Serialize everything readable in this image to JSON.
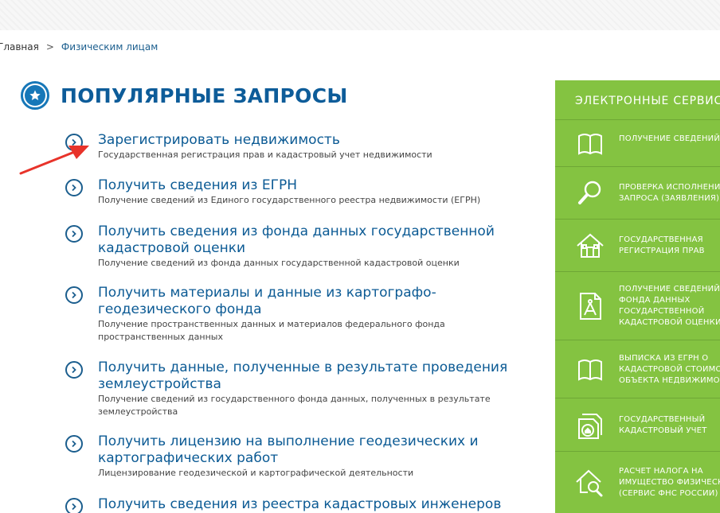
{
  "breadcrumb": {
    "home": "Главная",
    "separator": ">",
    "current": "Физическим лицам"
  },
  "section": {
    "title": "ПОПУЛЯРНЫЕ ЗАПРОСЫ",
    "icon": "star-icon"
  },
  "queries": [
    {
      "title_lines": [
        "Зарегистрировать недвижимость"
      ],
      "desc_lines": [
        "Государственная регистрация прав и кадастровый учет недвижимости"
      ]
    },
    {
      "title_lines": [
        "Получить сведения из ЕГРН"
      ],
      "desc_lines": [
        "Получение сведений из Единого государственного реестра недвижимости (ЕГРН)"
      ]
    },
    {
      "title_lines": [
        "Получить сведения из фонда данных государственной",
        "кадастровой оценки"
      ],
      "desc_lines": [
        "Получение сведений из фонда данных государственной кадастровой оценки"
      ]
    },
    {
      "title_lines": [
        "Получить материалы и данные из картографо-",
        "геодезического фонда"
      ],
      "desc_lines": [
        "Получение пространственных данных и материалов федерального фонда",
        "пространственных данных"
      ]
    },
    {
      "title_lines": [
        "Получить данные, полученные в результате проведения",
        "землеустройства"
      ],
      "desc_lines": [
        "Получение сведений из государственного фонда данных, полученных в результате",
        "землеустройства"
      ]
    },
    {
      "title_lines": [
        "Получить лицензию на выполнение геодезических и",
        "картографических работ"
      ],
      "desc_lines": [
        "Лицензирование геодезической и картографической деятельности"
      ]
    },
    {
      "title_lines": [
        "Получить сведения из реестра кадастровых инженеров"
      ],
      "desc_lines": []
    }
  ],
  "services": {
    "title": "ЭЛЕКТРОННЫЕ СЕРВИС",
    "items": [
      {
        "icon": "book-icon",
        "label_lines": [
          "ПОЛУЧЕНИЕ СВЕДЕНИЙ Е"
        ]
      },
      {
        "icon": "magnifier-icon",
        "label_lines": [
          "ПРОВЕРКА ИСПОЛНЕНИЯ",
          "ЗАПРОСА (ЗАЯВЛЕНИЯ)"
        ]
      },
      {
        "icon": "house-icon",
        "label_lines": [
          "ГОСУДАРСТВЕННАЯ",
          "РЕГИСТРАЦИЯ ПРАВ"
        ]
      },
      {
        "icon": "compass-document-icon",
        "label_lines": [
          "ПОЛУЧЕНИЕ СВЕДЕНИЙ И",
          "ФОНДА ДАННЫХ",
          "ГОСУДАРСТВЕННОЙ",
          "КАДАСТРОВОЙ ОЦЕНКИ"
        ]
      },
      {
        "icon": "book-icon",
        "label_lines": [
          "ВЫПИСКА ИЗ ЕГРН О",
          "КАДАСТРОВОЙ СТОИМО",
          "ОБЪЕКТА НЕДВИЖИМОС"
        ]
      },
      {
        "icon": "cadastral-document-icon",
        "label_lines": [
          "ГОСУДАРСТВЕННЫЙ",
          "КАДАСТРОВЫЙ УЧЕТ"
        ]
      },
      {
        "icon": "house-search-icon",
        "label_lines": [
          "РАСЧЕТ НАЛОГА НА",
          "ИМУЩЕСТВО ФИЗИЧЕСК",
          "(СЕРВИС ФНС РОССИИ)"
        ]
      }
    ]
  },
  "colors": {
    "link": "#0b5a94",
    "accent_blue": "#1677b8",
    "panel_green": "#84c341",
    "arrow_red": "#e8332a"
  }
}
